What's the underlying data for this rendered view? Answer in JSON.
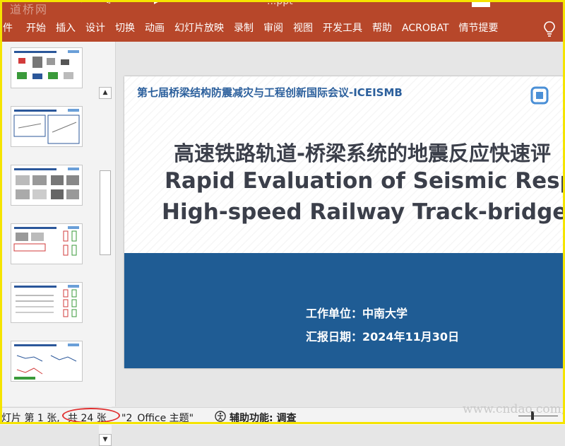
{
  "title_bar": {
    "watermark_logo": "道桥网",
    "doc_title": "...ppt",
    "user_initials": "?"
  },
  "ribbon": {
    "tabs": [
      "件",
      "开始",
      "插入",
      "设计",
      "切换",
      "动画",
      "幻灯片放映",
      "录制",
      "审阅",
      "视图",
      "开发工具",
      "帮助",
      "ACROBAT",
      "情节提要"
    ],
    "tell_me_icon": "lightbulb-icon"
  },
  "thumbnails": {
    "scroll_up_icon": "triangle-up-icon",
    "scroll_down_icon": "triangle-down-icon",
    "count_visible": 6
  },
  "slide": {
    "conference": "第七届桥梁结构防震减灾与工程创新国际会议-ICEISMB",
    "title_cn": "高速铁路轨道-桥梁系统的地震反应快速评",
    "title_en_1": "Rapid Evaluation of Seismic Response",
    "title_en_2": "High-speed Railway Track-bridge Sys",
    "unit": "工作单位：中南大学",
    "date": "汇报日期：2024年11月30日",
    "colors": {
      "conference": "#2b5f9c",
      "title": "#3b3f4a",
      "band": "#1f5c94"
    }
  },
  "status_bar": {
    "slide_position": "灯片 第 1 张,",
    "slide_total": "共 24 张",
    "theme": "\"2_Office 主题\"",
    "accessibility": "辅助功能: 调查",
    "accessibility_icon": "accessibility-icon",
    "annotation_color": "#e03030"
  },
  "site_watermark": "www.cndao.com,"
}
